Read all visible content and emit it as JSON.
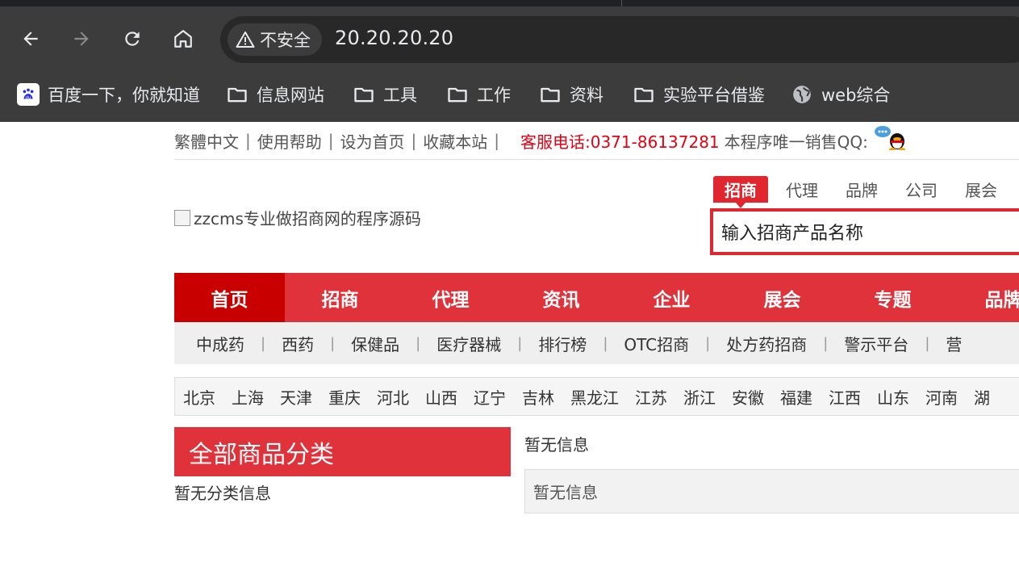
{
  "browser": {
    "security_label": "不安全",
    "url": "20.20.20.20",
    "bookmarks": [
      {
        "label": "百度一下，你就知道",
        "icon": "baidu-icon"
      },
      {
        "label": "信息网站",
        "icon": "folder-icon"
      },
      {
        "label": "工具",
        "icon": "folder-icon"
      },
      {
        "label": "工作",
        "icon": "folder-icon"
      },
      {
        "label": "资料",
        "icon": "folder-icon"
      },
      {
        "label": "实验平台借鉴",
        "icon": "folder-icon"
      },
      {
        "label": "web综合",
        "icon": "globe-icon"
      }
    ]
  },
  "topbar": {
    "links": [
      "繁體中文",
      "使用帮助",
      "设为首页",
      "收藏本站"
    ],
    "hotline": "客服电话:0371-86137281",
    "qq_text": "本程序唯一销售QQ:"
  },
  "logo": {
    "alt_text": "zzcms专业做招商网的程序源码"
  },
  "search": {
    "tabs": [
      "招商",
      "代理",
      "品牌",
      "公司",
      "展会"
    ],
    "active_tab": "招商",
    "value": "输入招商产品名称"
  },
  "main_nav": [
    "首页",
    "招商",
    "代理",
    "资讯",
    "企业",
    "展会",
    "专题",
    "品牌"
  ],
  "sub_nav": [
    "中成药",
    "西药",
    "保健品",
    "医疗器械",
    "排行榜",
    "OTC招商",
    "处方药招商",
    "警示平台",
    "营"
  ],
  "regions": [
    "北京",
    "上海",
    "天津",
    "重庆",
    "河北",
    "山西",
    "辽宁",
    "吉林",
    "黑龙江",
    "江苏",
    "浙江",
    "安徽",
    "福建",
    "江西",
    "山东",
    "河南",
    "湖"
  ],
  "categories": {
    "title": "全部商品分类",
    "empty_text": "暂无分类信息"
  },
  "info": {
    "empty_text": "暂无信息",
    "box_text": "暂无信息"
  },
  "colors": {
    "brand_red": "#e0323a",
    "active_red": "#c80000",
    "hotline_red": "#e60012",
    "chrome_bg": "#3c3c3c"
  }
}
